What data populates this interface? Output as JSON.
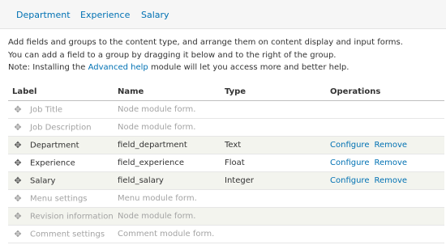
{
  "tabs": [
    {
      "label": "Department"
    },
    {
      "label": "Experience"
    },
    {
      "label": "Salary"
    }
  ],
  "help": {
    "line1": "Add fields and groups to the content type, and arrange them on content display and input forms.",
    "line2": "You can add a field to a group by dragging it below and to the right of the group.",
    "line3_before": "Note: Installing the ",
    "line3_link": "Advanced help",
    "line3_after": " module will let you access more and better help."
  },
  "table": {
    "headers": {
      "label": "Label",
      "name": "Name",
      "type": "Type",
      "operations": "Operations"
    },
    "rows": [
      {
        "label": "Job Title",
        "name": "Node module form.",
        "type": "",
        "configure": "",
        "remove": ""
      },
      {
        "label": "Job Description",
        "name": "Node module form.",
        "type": "",
        "configure": "",
        "remove": ""
      },
      {
        "label": "Department",
        "name": "field_department",
        "type": "Text",
        "configure": "Configure",
        "remove": "Remove"
      },
      {
        "label": "Experience",
        "name": "field_experience",
        "type": "Float",
        "configure": "Configure",
        "remove": "Remove"
      },
      {
        "label": "Salary",
        "name": "field_salary",
        "type": "Integer",
        "configure": "Configure",
        "remove": "Remove"
      },
      {
        "label": "Menu settings",
        "name": "Menu module form.",
        "type": "",
        "configure": "",
        "remove": ""
      },
      {
        "label": "Revision information",
        "name": "Node module form.",
        "type": "",
        "configure": "",
        "remove": ""
      },
      {
        "label": "Comment settings",
        "name": "Comment module form.",
        "type": "",
        "configure": "",
        "remove": ""
      }
    ]
  },
  "icons": {
    "drag_handle": "drag-handle-icon"
  },
  "colors": {
    "link": "#0071b3",
    "disabled_text": "#a3a3a3",
    "alt_row": "#f3f4ee"
  }
}
